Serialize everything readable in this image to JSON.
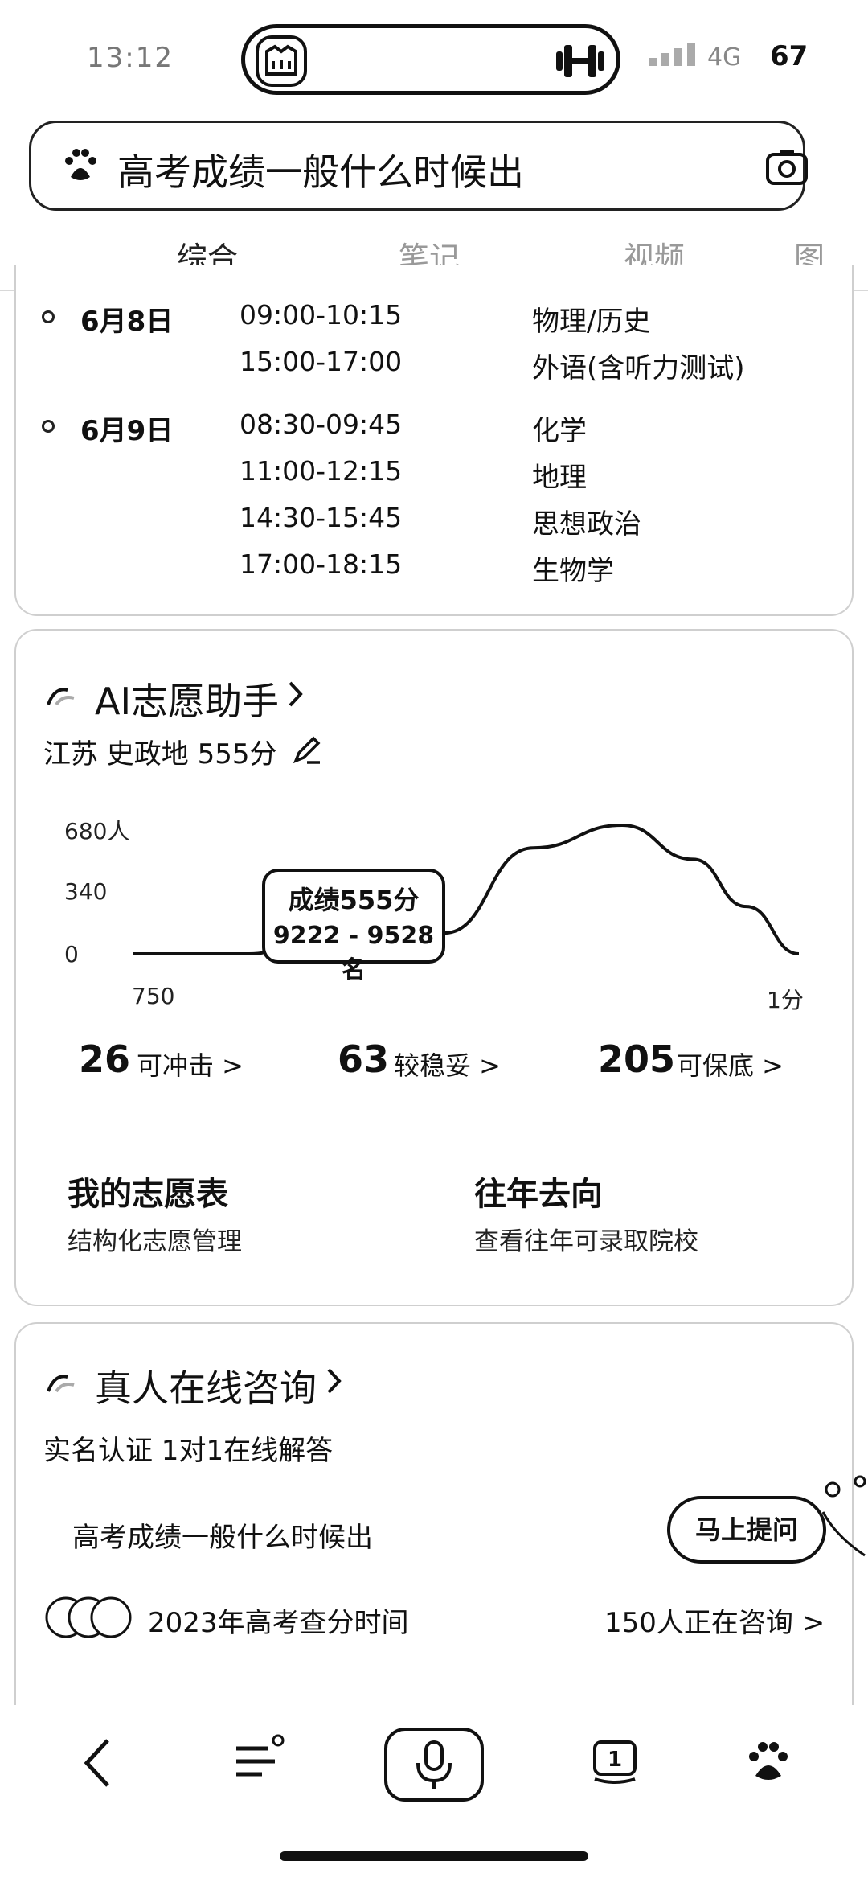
{
  "status": {
    "time": "13:12",
    "network": "4G",
    "battery": "67"
  },
  "search": {
    "query": "高考成绩一般什么时候出"
  },
  "tabs": [
    "综合",
    "笔记",
    "视频",
    "图"
  ],
  "schedule": [
    {
      "day": "6月8日",
      "slots": [
        {
          "time": "09:00-10:15",
          "subject": "物理/历史"
        },
        {
          "time": "15:00-17:00",
          "subject": "外语(含听力测试)"
        }
      ]
    },
    {
      "day": "6月9日",
      "slots": [
        {
          "time": "08:30-09:45",
          "subject": "化学"
        },
        {
          "time": "11:00-12:15",
          "subject": "地理"
        },
        {
          "time": "14:30-15:45",
          "subject": "思想政治"
        },
        {
          "time": "17:00-18:15",
          "subject": "生物学"
        }
      ]
    }
  ],
  "ai": {
    "title": "AI志愿助手",
    "profile": "江苏 史政地 555分",
    "chart_data": {
      "type": "line",
      "title": "",
      "xlabel": "",
      "ylabel": "",
      "y_ticks": [
        "680人",
        "340",
        "0"
      ],
      "x_ticks": [
        "750",
        "1分"
      ],
      "x": [
        750,
        620,
        555,
        520,
        480,
        400,
        300,
        200,
        120,
        60,
        1
      ],
      "y": [
        0,
        0,
        60,
        70,
        75,
        110,
        560,
        680,
        500,
        250,
        0
      ],
      "ylim": [
        0,
        680
      ],
      "xlim": [
        750,
        1
      ],
      "marker_x": 555,
      "callout": {
        "line1": "成绩555分",
        "line2": "9222 - 9528名"
      }
    },
    "stats": [
      {
        "num": "26",
        "label": "可冲击 >"
      },
      {
        "num": "63",
        "label": "较稳妥 >"
      },
      {
        "num": "205",
        "label": "可保底 >"
      }
    ],
    "links": [
      {
        "title": "我的志愿表",
        "sub": "结构化志愿管理"
      },
      {
        "title": "往年去向",
        "sub": "查看往年可录取院校"
      }
    ]
  },
  "consult": {
    "title": "真人在线咨询",
    "sub": "实名认证 1对1在线解答",
    "question": "高考成绩一般什么时候出",
    "ask": "马上提问",
    "topic": "2023年高考查分时间",
    "count": "150人正在咨询 >"
  }
}
